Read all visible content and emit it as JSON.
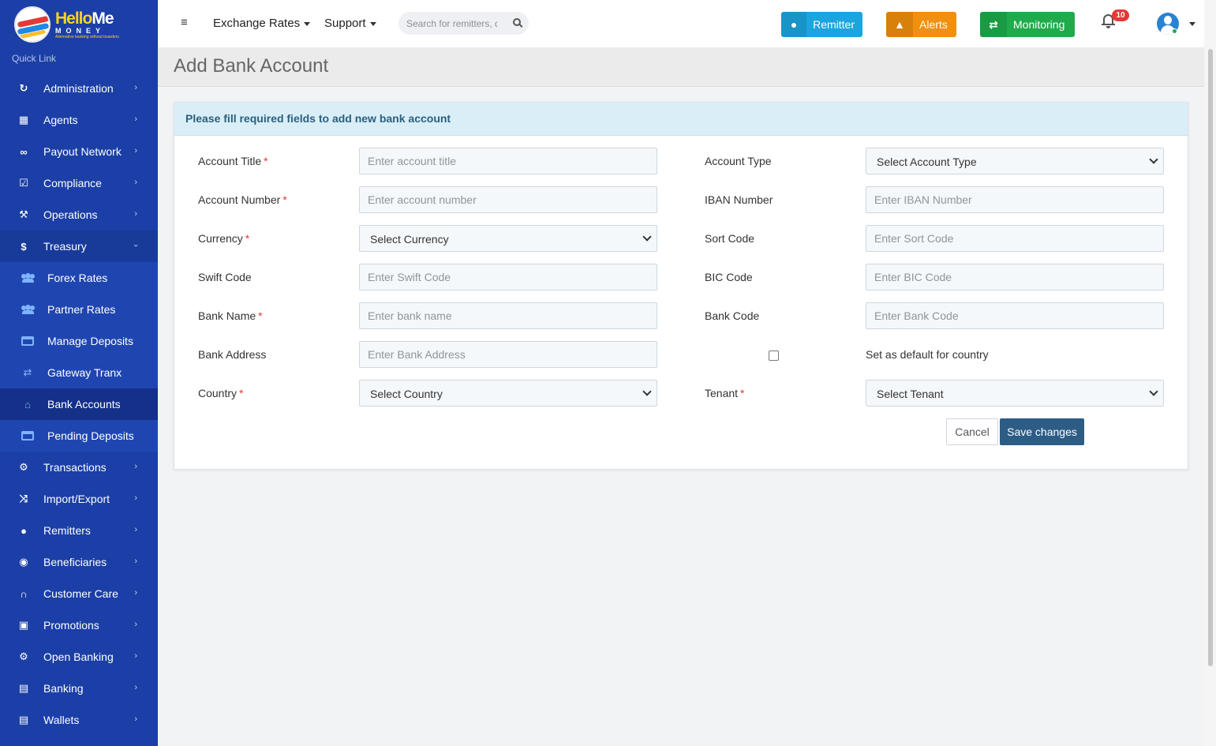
{
  "brand": {
    "name_part1": "Hello",
    "name_part2": "Me",
    "sub": "MONEY",
    "tagline": "Alternative banking without boarders"
  },
  "sidebar": {
    "quick_link": "Quick Link",
    "items_top": [
      {
        "label": "Administration",
        "icon": "recycle-icon"
      },
      {
        "label": "Agents",
        "icon": "building-icon"
      },
      {
        "label": "Payout Network",
        "icon": "handshake-icon"
      },
      {
        "label": "Compliance",
        "icon": "check-square-icon"
      },
      {
        "label": "Operations",
        "icon": "wrench-icon"
      }
    ],
    "treasury": {
      "label": "Treasury",
      "icon": "dollar-icon"
    },
    "treasury_sub": [
      {
        "label": "Forex Rates",
        "icon": "users-icon"
      },
      {
        "label": "Partner Rates",
        "icon": "users-icon"
      },
      {
        "label": "Manage Deposits",
        "icon": "credit-card-icon"
      },
      {
        "label": "Gateway Tranx",
        "icon": "exchange-icon"
      },
      {
        "label": "Bank Accounts",
        "icon": "bank-icon"
      },
      {
        "label": "Pending Deposits",
        "icon": "credit-card-icon"
      }
    ],
    "items_bottom": [
      {
        "label": "Transactions",
        "icon": "cogs-icon"
      },
      {
        "label": "Import/Export",
        "icon": "shuffle-icon"
      },
      {
        "label": "Remitters",
        "icon": "users-icon"
      },
      {
        "label": "Beneficiaries",
        "icon": "user-circle-icon"
      },
      {
        "label": "Customer Care",
        "icon": "headset-icon"
      },
      {
        "label": "Promotions",
        "icon": "gift-icon"
      },
      {
        "label": "Open Banking",
        "icon": "cog-icon"
      },
      {
        "label": "Banking",
        "icon": "money-icon"
      },
      {
        "label": "Wallets",
        "icon": "money-icon"
      }
    ]
  },
  "topbar": {
    "menu_exchange": "Exchange Rates",
    "menu_support": "Support",
    "search_placeholder": "Search for remitters, do",
    "remitter": "Remitter",
    "alerts": "Alerts",
    "monitoring": "Monitoring",
    "notification_count": "10"
  },
  "page": {
    "title": "Add Bank Account",
    "card_header": "Please fill required fields to add new bank account"
  },
  "form": {
    "account_title": {
      "label": "Account Title",
      "placeholder": "Enter account title"
    },
    "account_number": {
      "label": "Account Number",
      "placeholder": "Enter account number"
    },
    "currency": {
      "label": "Currency",
      "value": "Select Currency"
    },
    "swift_code": {
      "label": "Swift Code",
      "placeholder": "Enter Swift Code"
    },
    "bank_name": {
      "label": "Bank Name",
      "placeholder": "Enter bank name"
    },
    "bank_address": {
      "label": "Bank Address",
      "placeholder": "Enter Bank Address"
    },
    "country": {
      "label": "Country",
      "value": "Select Country"
    },
    "account_type": {
      "label": "Account Type",
      "value": "Select Account Type"
    },
    "iban_number": {
      "label": "IBAN Number",
      "placeholder": "Enter IBAN Number"
    },
    "sort_code": {
      "label": "Sort Code",
      "placeholder": "Enter Sort Code"
    },
    "bic_code": {
      "label": "BIC Code",
      "placeholder": "Enter BIC Code"
    },
    "bank_code": {
      "label": "Bank Code",
      "placeholder": "Enter Bank Code"
    },
    "default_country": {
      "label": "Set as default for country",
      "checked": false
    },
    "tenant": {
      "label": "Tenant",
      "value": "Select Tenant"
    },
    "required_mark": "*",
    "cancel": "Cancel",
    "save": "Save changes"
  }
}
